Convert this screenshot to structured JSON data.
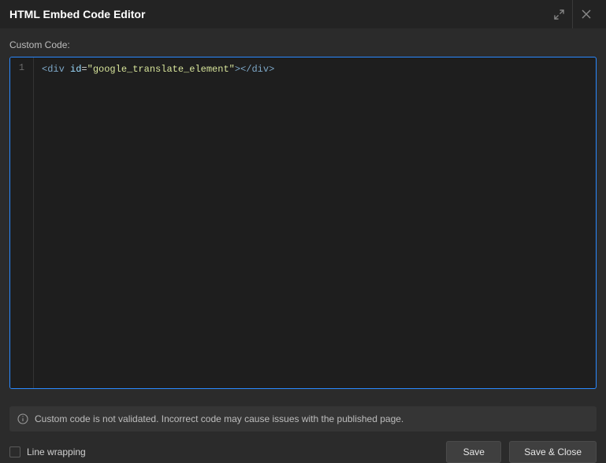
{
  "header": {
    "title": "HTML Embed Code Editor"
  },
  "label": "Custom Code:",
  "code": {
    "line_number": "1",
    "open_angle1": "<",
    "tag_open": "div",
    "space": " ",
    "attr": "id",
    "eq": "=",
    "str": "\"google_translate_element\"",
    "close_angle1": ">",
    "open_angle2": "</",
    "tag_close": "div",
    "close_angle2": ">"
  },
  "notice": {
    "text": "Custom code is not validated. Incorrect code may cause issues with the published page."
  },
  "footer": {
    "line_wrapping": "Line wrapping",
    "save": "Save",
    "save_close": "Save & Close"
  }
}
